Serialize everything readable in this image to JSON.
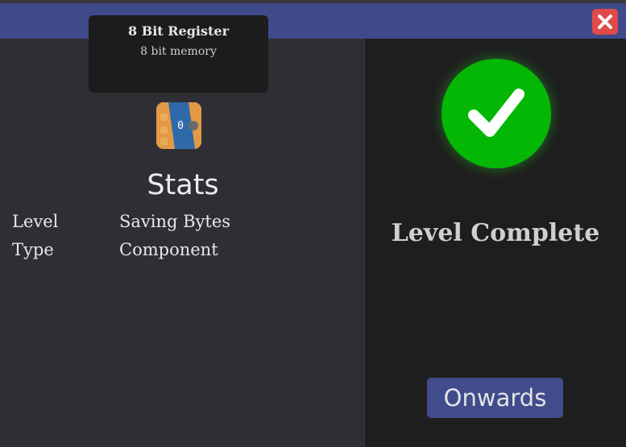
{
  "tooltip": {
    "title": "8 Bit Register",
    "subtitle": "8 bit memory"
  },
  "component": {
    "icon_name": "byte-register-icon",
    "icon_digit": "0"
  },
  "stats": {
    "heading": "Stats",
    "rows": [
      {
        "label": "Level",
        "value": "Saving Bytes"
      },
      {
        "label": "Type",
        "value": "Component"
      }
    ]
  },
  "result": {
    "icon_name": "checkmark-icon",
    "message": "Level Complete",
    "button_label": "Onwards"
  },
  "window": {
    "close_icon": "close-icon"
  },
  "colors": {
    "titlebar": "#3f4a8a",
    "close": "#e04a4a",
    "success": "#05b705",
    "button": "#414c8c"
  }
}
